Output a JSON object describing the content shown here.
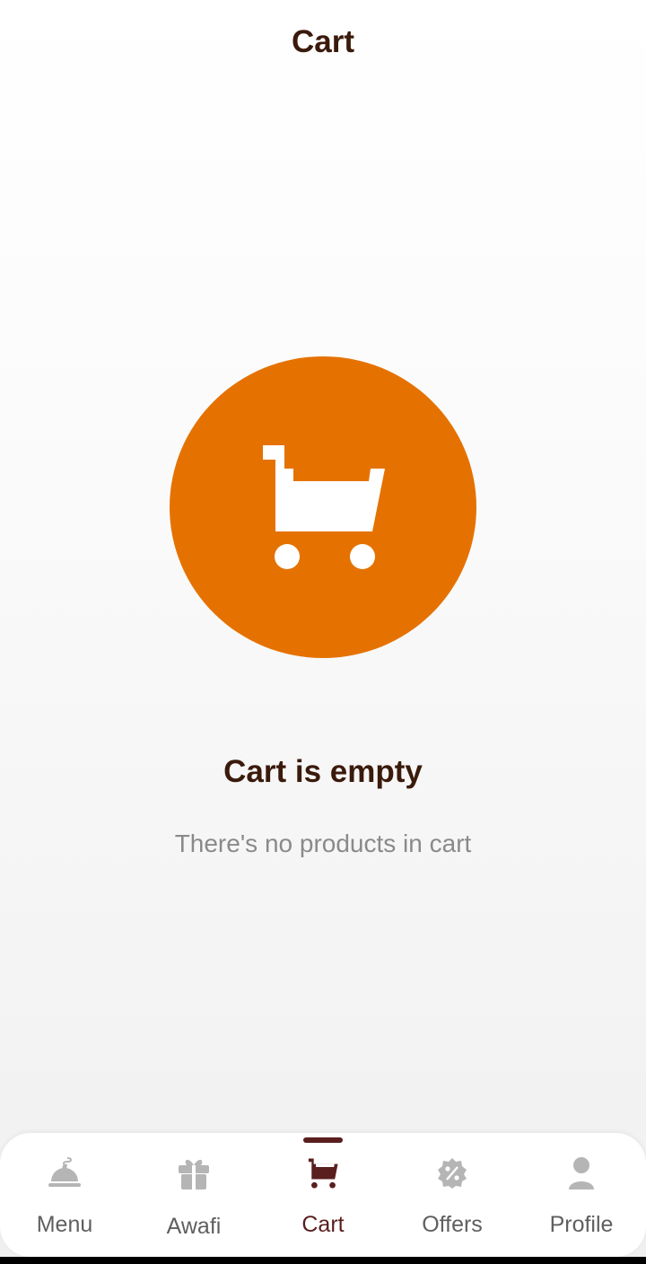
{
  "colors": {
    "accent": "#e57200",
    "title": "#3a1a0b",
    "subtitle": "#8a8a8a",
    "nav_active": "#5a1e1e",
    "nav_inactive": "#b5b5b5"
  },
  "header": {
    "title": "Cart"
  },
  "empty_state": {
    "icon": "shopping-cart-icon",
    "title": "Cart is empty",
    "subtitle": "There's no products in cart"
  },
  "bottom_nav": {
    "items": [
      {
        "label": "Menu",
        "icon": "cloche-icon",
        "active": false
      },
      {
        "label": "Awafi",
        "icon": "gift-icon",
        "active": false
      },
      {
        "label": "Cart",
        "icon": "cart-icon",
        "active": true
      },
      {
        "label": "Offers",
        "icon": "discount-badge-icon",
        "active": false
      },
      {
        "label": "Profile",
        "icon": "person-icon",
        "active": false
      }
    ]
  }
}
